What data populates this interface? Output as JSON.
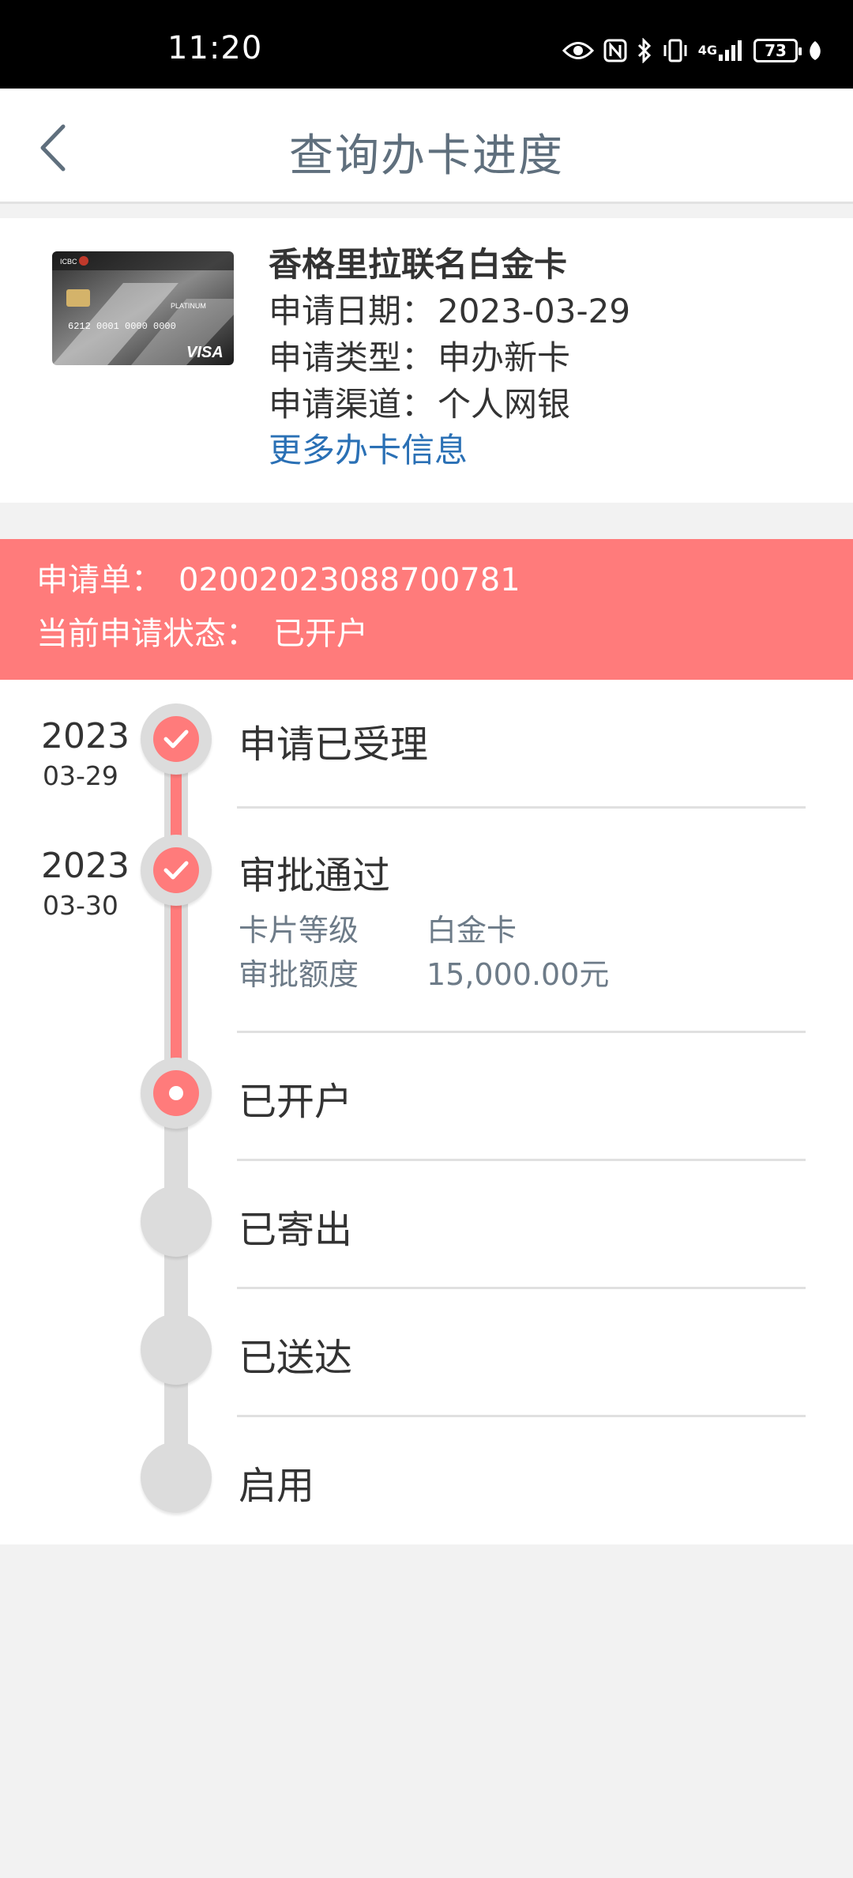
{
  "status_bar": {
    "time": "11:20",
    "icons": [
      "eye-icon",
      "nfc-icon",
      "bluetooth-icon",
      "vibrate-icon",
      "signal-4g-icon"
    ],
    "signal_label": "4G",
    "battery": "73"
  },
  "header": {
    "title": "查询办卡进度",
    "back_icon": "chevron-left-icon"
  },
  "card": {
    "name": "香格里拉联名白金卡",
    "apply_date_label": "申请日期：",
    "apply_date": "2023-03-29",
    "apply_type_label": "申请类型：",
    "apply_type": "申办新卡",
    "apply_channel_label": "申请渠道：",
    "apply_channel": "个人网银",
    "more_link": "更多办卡信息",
    "image_text": {
      "brand": "ICBC",
      "level": "PLATINUM",
      "network": "VISA"
    }
  },
  "application": {
    "number_label": "申请单：",
    "number": "02002023088700781",
    "status_label": "当前申请状态：",
    "status": "已开户"
  },
  "timeline": {
    "steps": [
      {
        "year": "2023",
        "md": "03-29",
        "title": "申请已受理",
        "state": "done"
      },
      {
        "year": "2023",
        "md": "03-30",
        "title": "审批通过",
        "state": "done",
        "details": [
          {
            "key": "卡片等级",
            "value": "白金卡"
          },
          {
            "key": "审批额度",
            "value": "15,000.00元"
          }
        ]
      },
      {
        "title": "已开户",
        "state": "current"
      },
      {
        "title": "已寄出",
        "state": "pending"
      },
      {
        "title": "已送达",
        "state": "pending"
      },
      {
        "title": "启用",
        "state": "pending"
      }
    ]
  },
  "colors": {
    "accent": "#ff7b7b",
    "link": "#2a70b5",
    "title_gray": "#5f6f7d",
    "track_gray": "#dcdcdc"
  }
}
